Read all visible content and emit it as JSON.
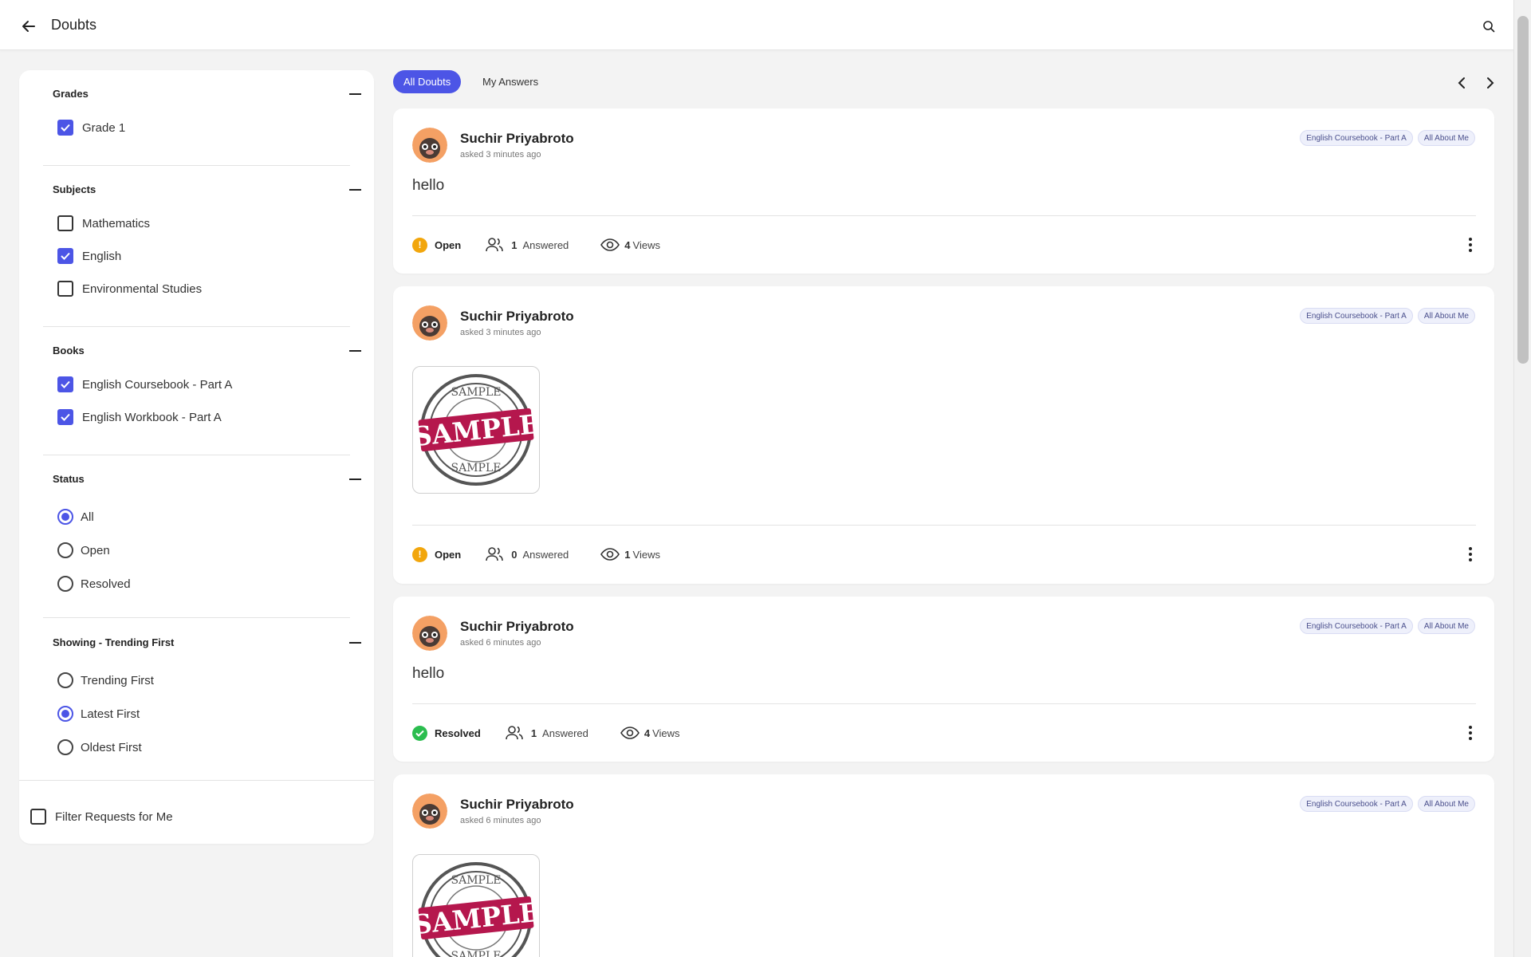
{
  "header": {
    "title": "Doubts"
  },
  "filters": {
    "grades": {
      "title": "Grades",
      "options": [
        {
          "label": "Grade 1",
          "checked": true
        }
      ]
    },
    "subjects": {
      "title": "Subjects",
      "options": [
        {
          "label": "Mathematics",
          "checked": false
        },
        {
          "label": "English",
          "checked": true
        },
        {
          "label": "Environmental Studies",
          "checked": false
        }
      ]
    },
    "books": {
      "title": "Books",
      "options": [
        {
          "label": "English Coursebook - Part A",
          "checked": true
        },
        {
          "label": "English Workbook - Part A",
          "checked": true
        }
      ]
    },
    "status": {
      "title": "Status",
      "options": [
        {
          "label": "All",
          "selected": true
        },
        {
          "label": "Open",
          "selected": false
        },
        {
          "label": "Resolved",
          "selected": false
        }
      ]
    },
    "sort": {
      "title": "Showing - Trending First",
      "options": [
        {
          "label": "Trending First",
          "selected": false
        },
        {
          "label": "Latest First",
          "selected": true
        },
        {
          "label": "Oldest First",
          "selected": false
        }
      ]
    },
    "requests": {
      "label": "Filter Requests for Me",
      "checked": false
    }
  },
  "tabs": {
    "all": "All Doubts",
    "mine": "My Answers",
    "active": "all"
  },
  "doubts": [
    {
      "author": "Suchir Priyabroto",
      "time": "asked 3 minutes ago",
      "tags": [
        "English Coursebook - Part A",
        "All About Me"
      ],
      "text": "hello",
      "status": "Open",
      "answered_count": "1",
      "answered_label": "Answered",
      "views_count": "4",
      "views_label": "Views",
      "image_text": ""
    },
    {
      "author": "Suchir Priyabroto",
      "time": "asked 3 minutes ago",
      "tags": [
        "English Coursebook - Part A",
        "All About Me"
      ],
      "text": "",
      "image_text": "SAMPLE",
      "status": "Open",
      "answered_count": "0",
      "answered_label": "Answered",
      "views_count": "1",
      "views_label": "Views"
    },
    {
      "author": "Suchir Priyabroto",
      "time": "asked 6 minutes ago",
      "tags": [
        "English Coursebook - Part A",
        "All About Me"
      ],
      "text": "hello",
      "status": "Resolved",
      "answered_count": "1",
      "answered_label": "Answered",
      "views_count": "4",
      "views_label": "Views",
      "image_text": ""
    },
    {
      "author": "Suchir Priyabroto",
      "time": "asked 6 minutes ago",
      "tags": [
        "English Coursebook - Part A",
        "All About Me"
      ],
      "text": "",
      "image_text": "SAMPLE"
    }
  ],
  "colors": {
    "accent": "#4c55e6",
    "open": "#f2a60c",
    "resolved": "#2bbd4f"
  },
  "icons": {
    "back": "arrow-left-icon",
    "search": "search-icon",
    "answered": "users-icon",
    "views": "eye-icon",
    "more": "kebab-icon"
  }
}
